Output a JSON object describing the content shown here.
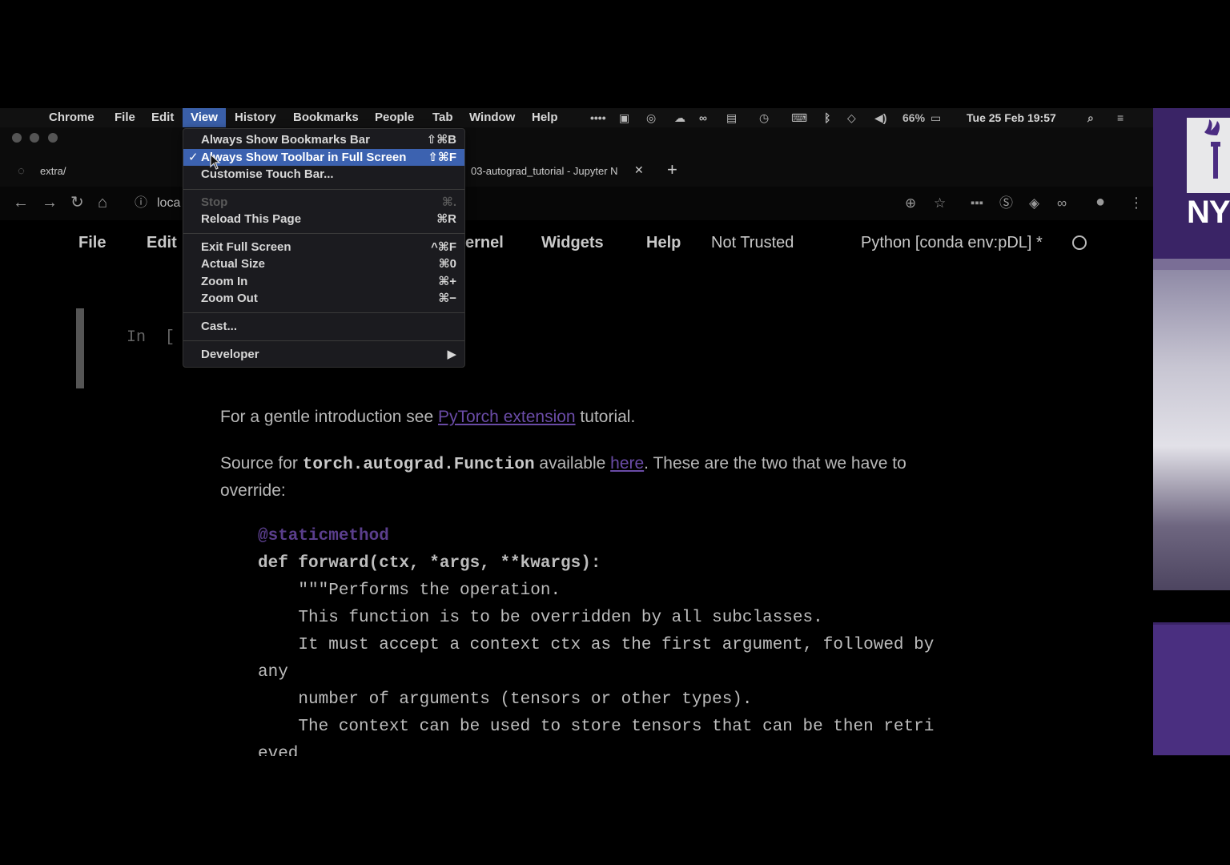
{
  "menubar": {
    "apple": "",
    "items": [
      "Chrome",
      "File",
      "Edit",
      "View",
      "History",
      "Bookmarks",
      "People",
      "Tab",
      "Window",
      "Help"
    ],
    "battery": "66%",
    "datetime": "Tue 25 Feb  19:57"
  },
  "browser": {
    "tabs": [
      {
        "title": "extra/"
      },
      {
        "title": "03-autograd_tutorial - Jupyter N"
      }
    ],
    "new_tab": "+",
    "close_tab": "✕",
    "address": "loca"
  },
  "jupyter": {
    "menu": [
      "File",
      "Edit",
      "ernel",
      "Widgets",
      "Help"
    ],
    "trust": "Not Trusted",
    "kernel": "Python [conda env:pDL] *",
    "prompt": "In  [",
    "para1_before": "For a gentle introduction see ",
    "para1_link": "PyTorch extension",
    "para1_after": " tutorial.",
    "para2_before": "Source for ",
    "para2_code": "torch.autograd.Function",
    "para2_mid": " available ",
    "para2_link": "here",
    "para2_after": ". These are the two that we have to",
    "para2_line2": "override:",
    "code_lines": [
      "@staticmethod",
      "def forward(ctx, *args, **kwargs):",
      "    \"\"\"Performs the operation.",
      "    This function is to be overridden by all subclasses.",
      "    It must accept a context ctx as the first argument, followed by",
      "any",
      "    number of arguments (tensors or other types).",
      "    The context can be used to store tensors that can be then retri",
      "eved"
    ]
  },
  "view_menu": {
    "items": [
      {
        "label": "Always Show Bookmarks Bar",
        "shortcut": "⇧⌘B"
      },
      {
        "label": "Always Show Toolbar in Full Screen",
        "shortcut": "⇧⌘F",
        "checked": true
      },
      {
        "label": "Customise Touch Bar...",
        "shortcut": ""
      },
      {
        "label": "Stop",
        "shortcut": "⌘.",
        "disabled": true
      },
      {
        "label": "Reload This Page",
        "shortcut": "⌘R"
      },
      {
        "label": "Exit Full Screen",
        "shortcut": "^⌘F"
      },
      {
        "label": "Actual Size",
        "shortcut": "⌘0"
      },
      {
        "label": "Zoom In",
        "shortcut": "⌘+"
      },
      {
        "label": "Zoom Out",
        "shortcut": "⌘−"
      },
      {
        "label": "Cast...",
        "shortcut": ""
      },
      {
        "label": "Developer",
        "shortcut": "▶"
      }
    ]
  },
  "video": {
    "logo": "NY"
  },
  "colors": {
    "menu_highlight": "#3c62b0",
    "link": "#6a4ba6",
    "nyu_purple": "#3a2466"
  }
}
